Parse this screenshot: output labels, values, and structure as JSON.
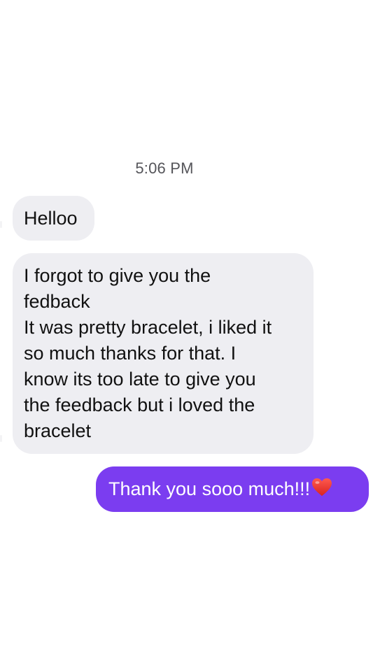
{
  "conversation": {
    "timestamp": "5:06 PM",
    "messages": [
      {
        "direction": "received",
        "lines": [
          "Helloo"
        ]
      },
      {
        "direction": "received",
        "lines": [
          "I forgot to give you the",
          "fedback",
          "It was pretty bracelet, i liked it",
          "so much thanks for that. I",
          "know its too late to give you",
          "the feedback but i loved the",
          "bracelet"
        ]
      },
      {
        "direction": "sent",
        "text": "Thank you sooo much!!!",
        "emoji": "red-heart-icon"
      }
    ]
  },
  "colors": {
    "background": "#ffffff",
    "received_bubble": "#eeeef2",
    "sent_bubble": "#7b3df0",
    "heart": "#e8332f"
  }
}
